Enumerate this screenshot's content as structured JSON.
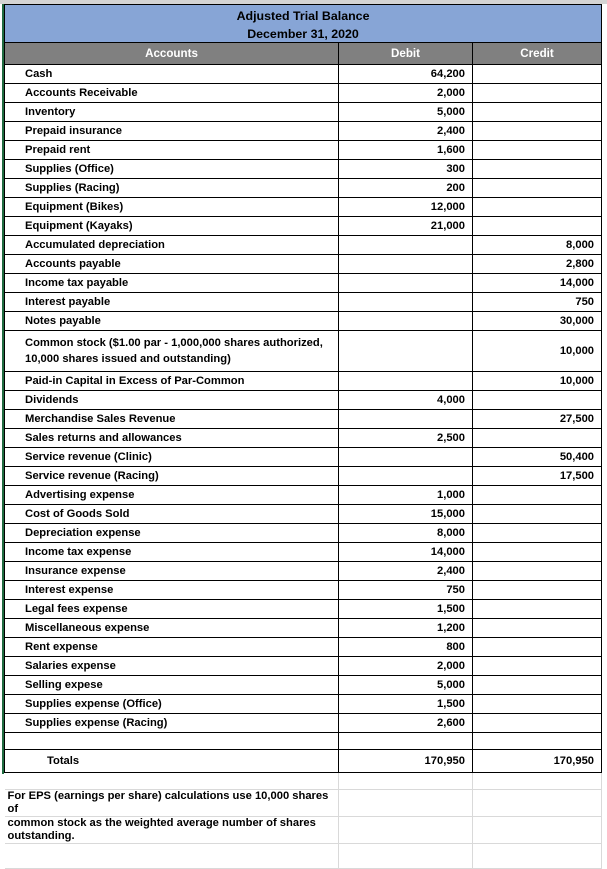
{
  "document": {
    "title_line1": "Adjusted Trial Balance",
    "title_line2": "December 31, 2020"
  },
  "colors": {
    "title_band": "#87a5d6",
    "header_band": "#808080",
    "header_text": "#ffffff",
    "grid_line": "#000000",
    "sheet_grid": "#d9d9d9",
    "left_edge": "#1f6b40"
  },
  "columns": {
    "accounts": "Accounts",
    "debit": "Debit",
    "credit": "Credit"
  },
  "rows": [
    {
      "account": "Cash",
      "debit": "64,200",
      "credit": ""
    },
    {
      "account": "Accounts Receivable",
      "debit": "2,000",
      "credit": ""
    },
    {
      "account": "Inventory",
      "debit": "5,000",
      "credit": ""
    },
    {
      "account": "Prepaid insurance",
      "debit": "2,400",
      "credit": ""
    },
    {
      "account": "Prepaid rent",
      "debit": "1,600",
      "credit": ""
    },
    {
      "account": "Supplies (Office)",
      "debit": "300",
      "credit": ""
    },
    {
      "account": "Supplies (Racing)",
      "debit": "200",
      "credit": ""
    },
    {
      "account": "Equipment (Bikes)",
      "debit": "12,000",
      "credit": ""
    },
    {
      "account": "Equipment (Kayaks)",
      "debit": "21,000",
      "credit": ""
    },
    {
      "account": "Accumulated depreciation",
      "debit": "",
      "credit": "8,000"
    },
    {
      "account": "Accounts payable",
      "debit": "",
      "credit": "2,800"
    },
    {
      "account": "Income tax payable",
      "debit": "",
      "credit": "14,000"
    },
    {
      "account": "Interest payable",
      "debit": "",
      "credit": "750"
    },
    {
      "account": "Notes payable",
      "debit": "",
      "credit": "30,000"
    },
    {
      "account": "Common stock ($1.00 par - 1,000,000 shares authorized, 10,000 shares issued and outstanding)",
      "debit": "",
      "credit": "10,000",
      "tall": true
    },
    {
      "account": "Paid-in Capital in Excess of Par-Common",
      "debit": "",
      "credit": "10,000"
    },
    {
      "account": "Dividends",
      "debit": "4,000",
      "credit": ""
    },
    {
      "account": "Merchandise Sales Revenue",
      "debit": "",
      "credit": "27,500"
    },
    {
      "account": "Sales returns and allowances",
      "debit": "2,500",
      "credit": ""
    },
    {
      "account": "Service revenue (Clinic)",
      "debit": "",
      "credit": "50,400"
    },
    {
      "account": "Service revenue (Racing)",
      "debit": "",
      "credit": "17,500"
    },
    {
      "account": "Advertising expense",
      "debit": "1,000",
      "credit": ""
    },
    {
      "account": "Cost of Goods Sold",
      "debit": "15,000",
      "credit": ""
    },
    {
      "account": "Depreciation expense",
      "debit": "8,000",
      "credit": ""
    },
    {
      "account": "Income tax expense",
      "debit": "14,000",
      "credit": ""
    },
    {
      "account": "Insurance expense",
      "debit": "2,400",
      "credit": ""
    },
    {
      "account": "Interest expense",
      "debit": "750",
      "credit": ""
    },
    {
      "account": "Legal fees expense",
      "debit": "1,500",
      "credit": ""
    },
    {
      "account": "Miscellaneous expense",
      "debit": "1,200",
      "credit": ""
    },
    {
      "account": "Rent expense",
      "debit": "800",
      "credit": ""
    },
    {
      "account": "Salaries expense",
      "debit": "2,000",
      "credit": ""
    },
    {
      "account": "Selling expese",
      "debit": "5,000",
      "credit": ""
    },
    {
      "account": "Supplies expense (Office)",
      "debit": "1,500",
      "credit": ""
    },
    {
      "account": "Supplies expense (Racing)",
      "debit": "2,600",
      "credit": ""
    },
    {
      "account": "",
      "debit": "",
      "credit": "",
      "blank": true
    }
  ],
  "totals": {
    "label": "Totals",
    "debit": "170,950",
    "credit": "170,950"
  },
  "footnote": {
    "line1": "For EPS (earnings per share) calculations use 10,000 shares of",
    "line2": "common stock as the weighted average number of shares outstanding."
  }
}
